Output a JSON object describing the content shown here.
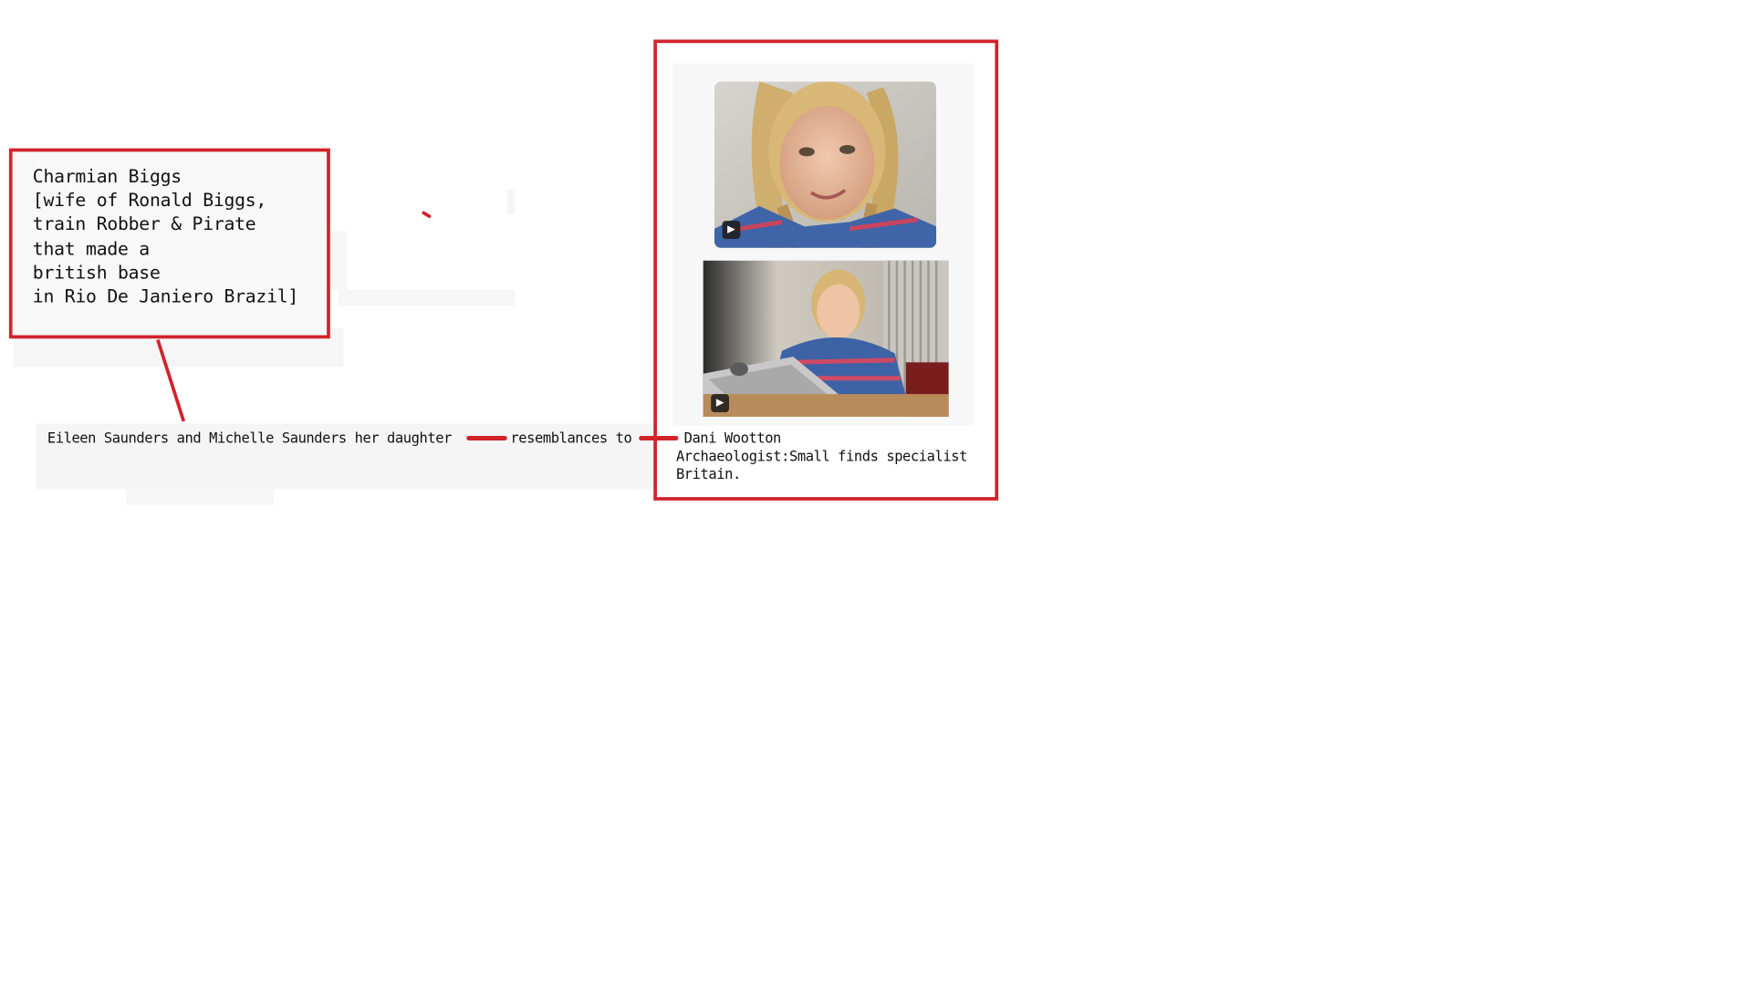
{
  "left_box": {
    "lines": [
      "Charmian Biggs",
      "[wife of Ronald Biggs,",
      "train Robber & Pirate",
      "that made a",
      "british base",
      "in Rio De Janiero Brazil]"
    ]
  },
  "subject": "Eileen Saunders and Michelle Saunders her daughter",
  "relation": "resemblances to",
  "right_caption": {
    "name": "Dani Wootton",
    "role": "Archaeologist:Small finds specialist",
    "location": "Britain."
  },
  "photos": [
    {
      "badge": "▶"
    },
    {
      "badge": "▶"
    }
  ],
  "colors": {
    "accent": "#d2232a",
    "panel": "#f6f6f6"
  }
}
